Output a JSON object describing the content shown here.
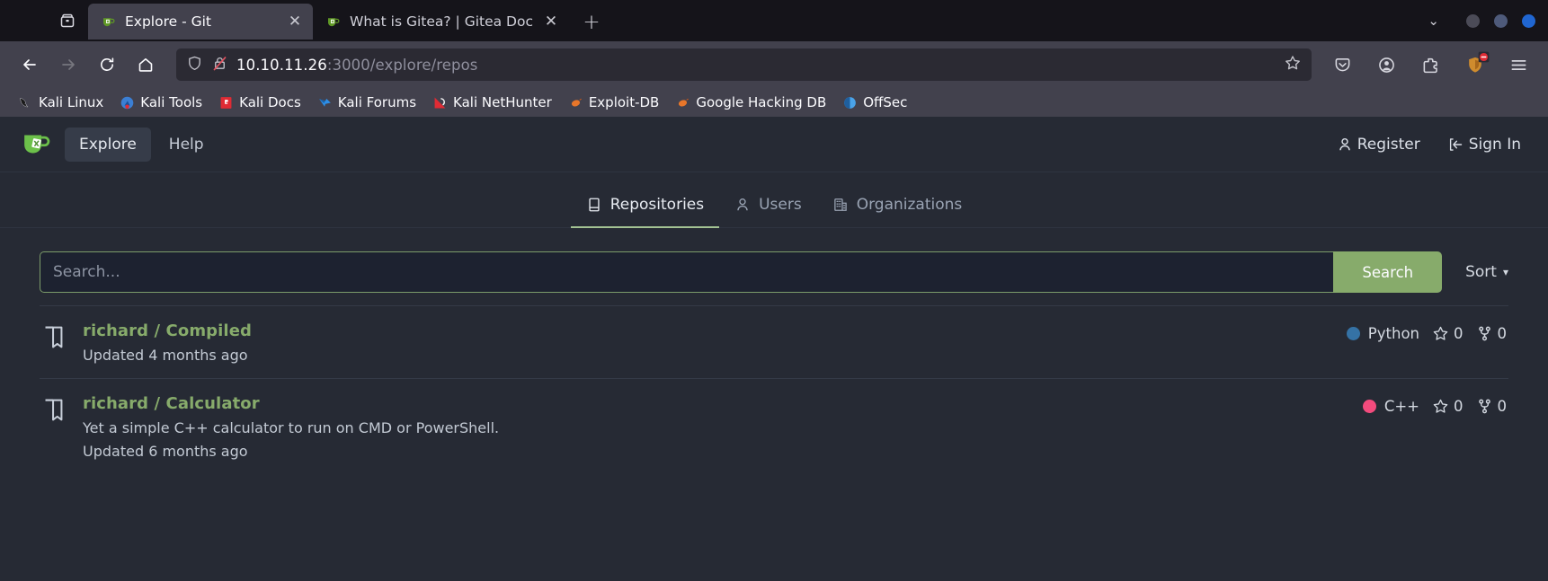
{
  "browser": {
    "firefox_view_label": "firefox-view",
    "tabs": [
      {
        "title": "Explore - Git",
        "favicon": "gitea-icon",
        "close_label": "✕",
        "active": true
      },
      {
        "title": "What is Gitea? | Gitea Doc",
        "favicon": "gitea-icon",
        "close_label": "✕",
        "active": false
      }
    ],
    "new_tab_label": "+",
    "list_all_tabs_label": "⌄",
    "window_buttons": [
      "minimize",
      "maximize",
      "close"
    ],
    "nav": {
      "back_label": "←",
      "forward_label": "→",
      "reload_label": "⟳",
      "home_label": "⌂"
    },
    "url": {
      "host": "10.10.11.26",
      "path": ":3000/explore/repos",
      "shield_icon": "shield-icon",
      "lock_icon": "lock-crossed-icon",
      "bookmark_icon": "star-icon"
    },
    "toolbar_right": [
      {
        "name": "pocket-icon"
      },
      {
        "name": "account-icon"
      },
      {
        "name": "extensions-icon"
      },
      {
        "name": "ublock-origin-icon"
      },
      {
        "name": "hamburger-menu-icon"
      }
    ],
    "bookmarks": [
      {
        "label": "Kali Linux",
        "icon": "kali-dragon-icon"
      },
      {
        "label": "Kali Tools",
        "icon": "kali-tools-icon"
      },
      {
        "label": "Kali Docs",
        "icon": "kali-docs-icon"
      },
      {
        "label": "Kali Forums",
        "icon": "kali-forums-icon"
      },
      {
        "label": "Kali NetHunter",
        "icon": "kali-nethunter-icon"
      },
      {
        "label": "Exploit-DB",
        "icon": "exploit-db-icon"
      },
      {
        "label": "Google Hacking DB",
        "icon": "google-hacking-db-icon"
      },
      {
        "label": "OffSec",
        "icon": "offsec-icon"
      }
    ]
  },
  "gitea": {
    "logo_name": "gitea-logo",
    "nav_items": [
      {
        "label": "Explore",
        "active": true
      },
      {
        "label": "Help",
        "active": false
      }
    ],
    "nav_right": [
      {
        "label": "Register",
        "icon": "person-icon"
      },
      {
        "label": "Sign In",
        "icon": "sign-in-icon"
      }
    ],
    "explore_tabs": [
      {
        "label": "Repositories",
        "icon": "repo-icon",
        "active": true
      },
      {
        "label": "Users",
        "icon": "person-icon",
        "active": false
      },
      {
        "label": "Organizations",
        "icon": "organization-icon",
        "active": false
      }
    ],
    "search": {
      "placeholder": "Search...",
      "value": "",
      "button_label": "Search",
      "sort_label": "Sort",
      "sort_caret": "▾"
    },
    "repos": [
      {
        "name": "richard / Compiled",
        "description": "",
        "updated": "Updated 4 months ago",
        "language": "Python",
        "language_color": "#3572A5",
        "stars": "0",
        "forks": "0"
      },
      {
        "name": "richard / Calculator",
        "description": "Yet a simple C++ calculator to run on CMD or PowerShell.",
        "updated": "Updated 6 months ago",
        "language": "C++",
        "language_color": "#f34b7d",
        "stars": "0",
        "forks": "0"
      }
    ]
  }
}
